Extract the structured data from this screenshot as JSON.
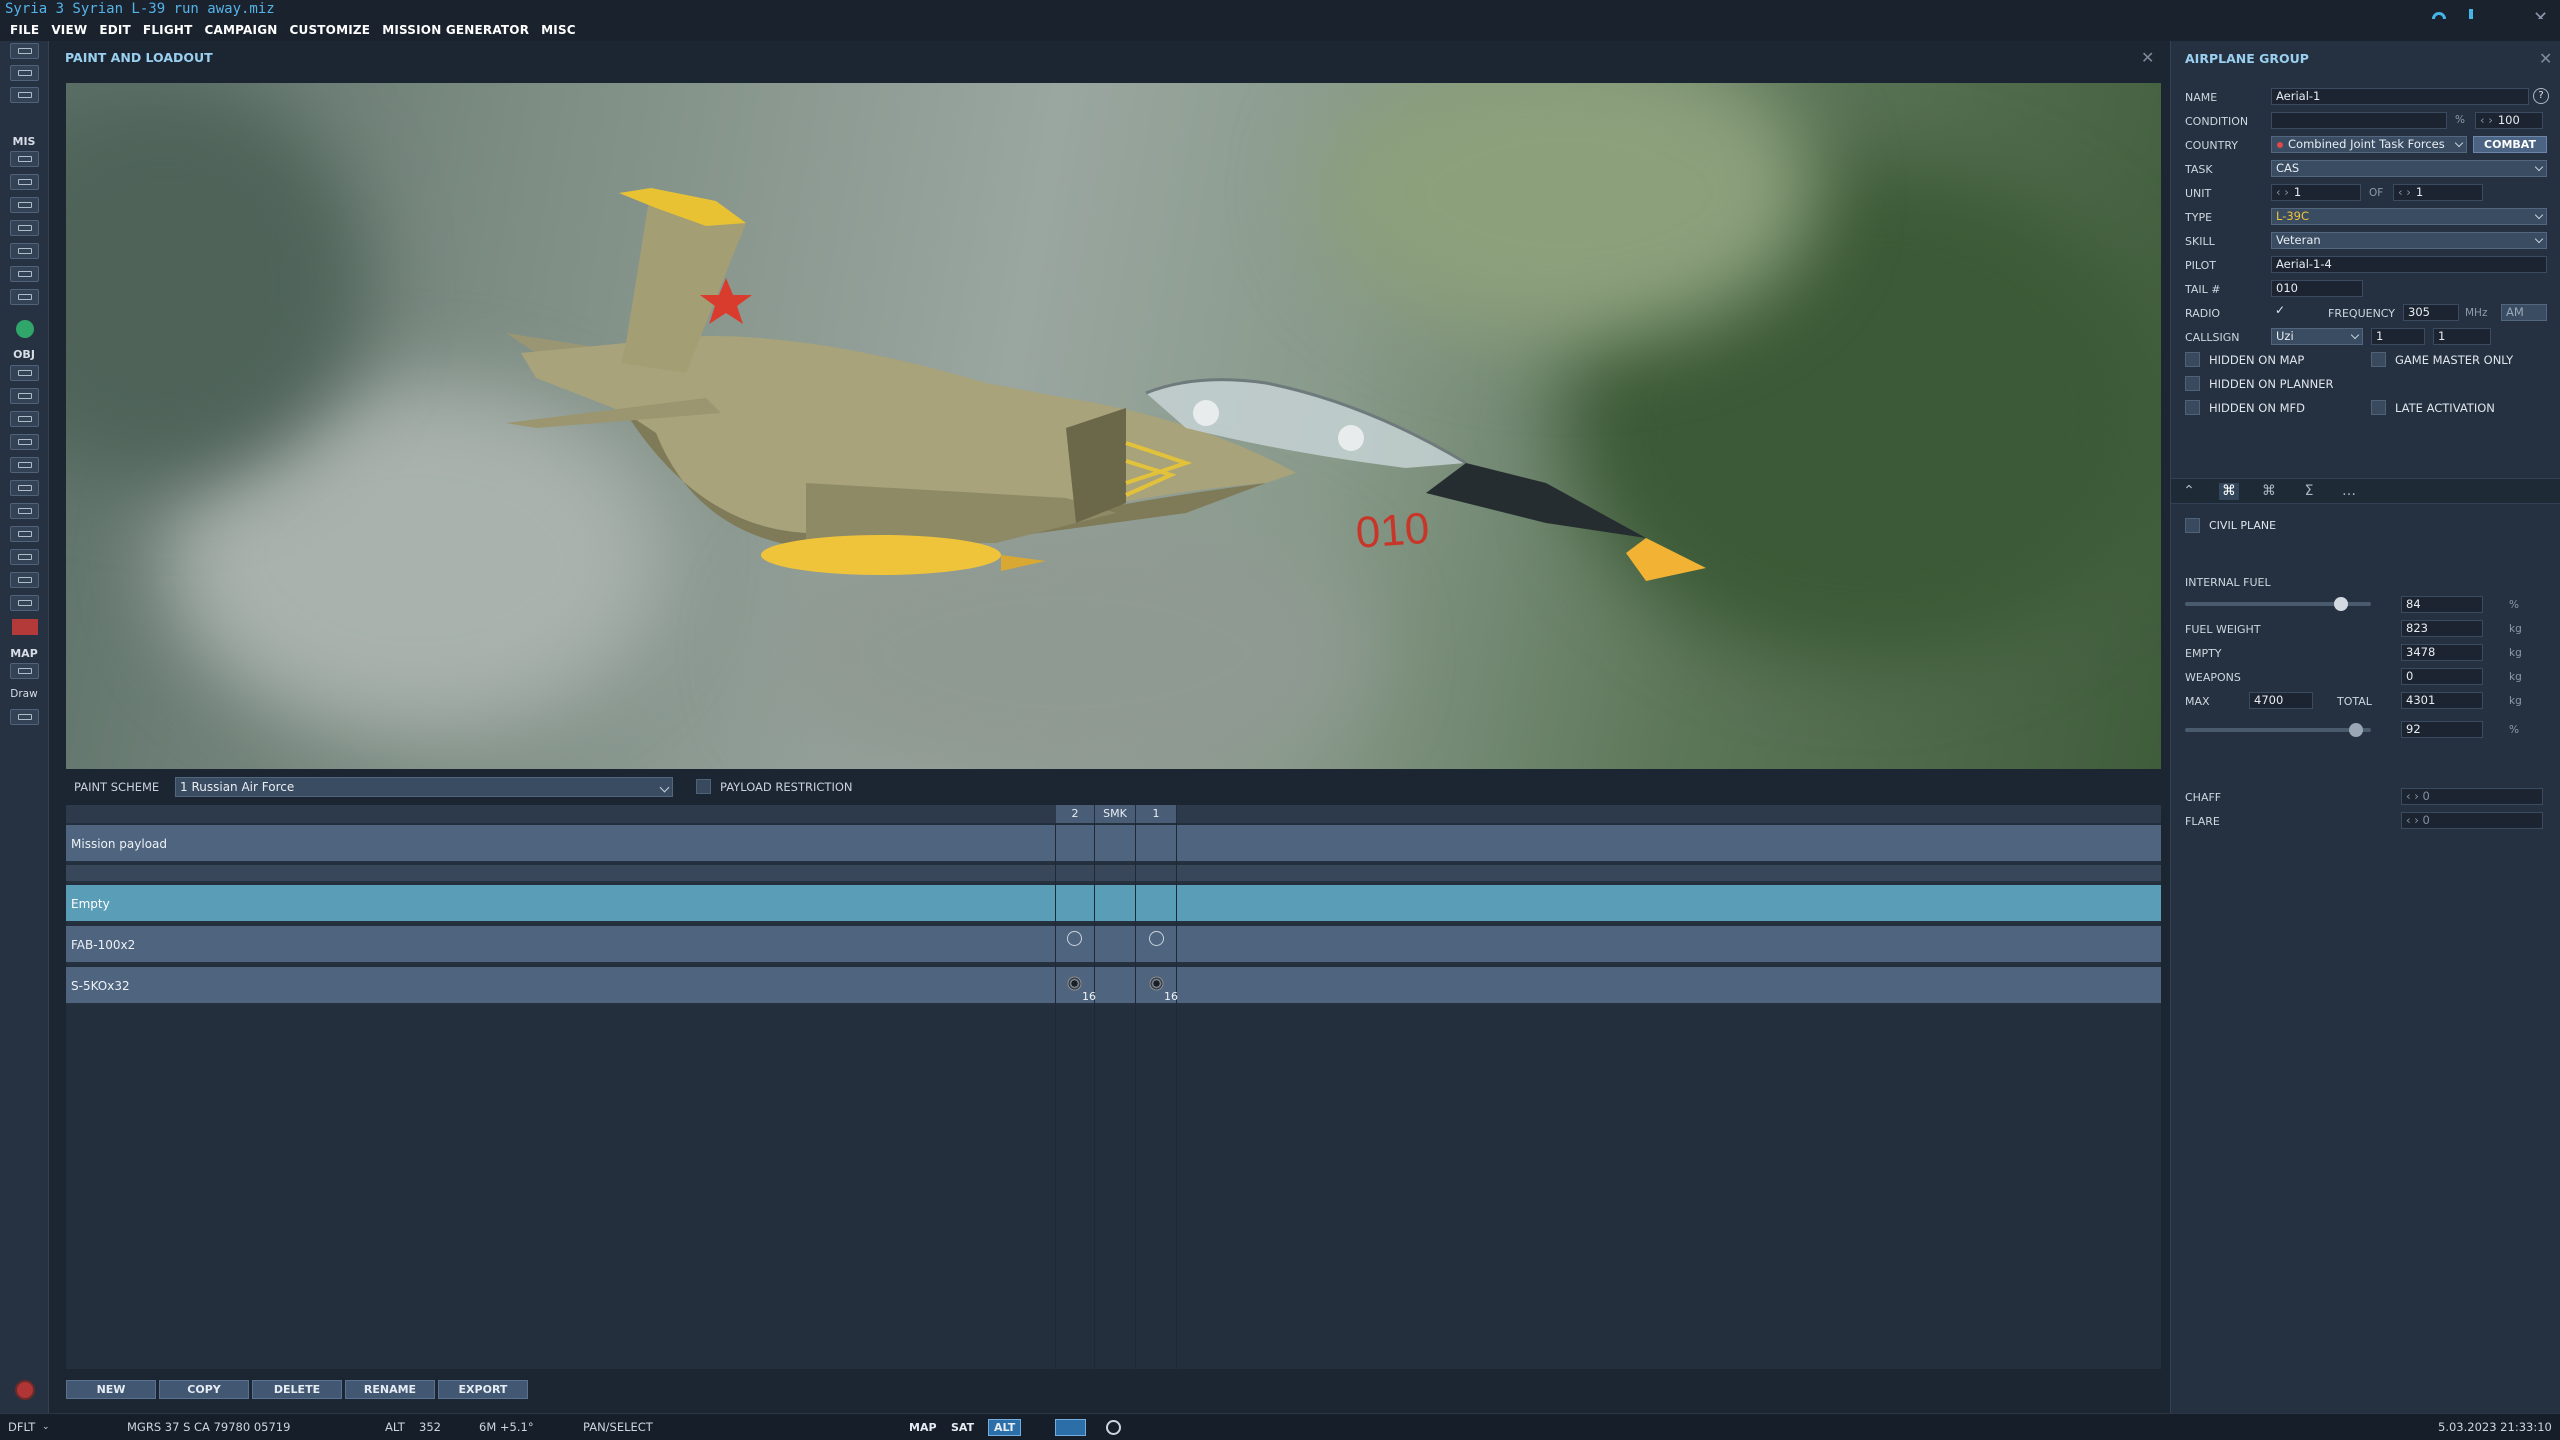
{
  "window": {
    "title": "Syria 3 Syrian L-39 run away.miz"
  },
  "menu": [
    "FILE",
    "VIEW",
    "EDIT",
    "FLIGHT",
    "CAMPAIGN",
    "CUSTOMIZE",
    "MISSION GENERATOR",
    "MISC"
  ],
  "toolbar": {
    "mis_label": "MIS",
    "obj_label": "OBJ",
    "map_label": "MAP",
    "draw_label": "Draw"
  },
  "paint_loadout": {
    "title": "PAINT AND LOADOUT",
    "paint_scheme_label": "PAINT SCHEME",
    "paint_scheme_value": "1 Russian Air Force",
    "payload_restriction_label": "PAYLOAD RESTRICTION",
    "aircraft_tail_number": "010",
    "columns": [
      "2",
      "SMK",
      "1"
    ],
    "mission_payload_label": "Mission payload",
    "rows": [
      {
        "name": "Empty",
        "selected": true,
        "slot2": "",
        "slot1": ""
      },
      {
        "name": "FAB-100x2",
        "selected": false,
        "slot2": "",
        "slot1": ""
      },
      {
        "name": "S-5KOx32",
        "selected": false,
        "slot2": "16",
        "slot1": "16"
      }
    ],
    "buttons": {
      "new": "NEW",
      "copy": "COPY",
      "delete": "DELETE",
      "rename": "RENAME",
      "export": "EXPORT"
    }
  },
  "airplane_group": {
    "title": "AIRPLANE GROUP",
    "name_label": "NAME",
    "name_value": "Aerial-1",
    "help_icon": "?",
    "condition_label": "CONDITION",
    "condition_unit": "%",
    "condition_value": "100",
    "country_label": "COUNTRY",
    "country_value": "Combined Joint Task Forces",
    "combat_label": "COMBAT",
    "task_label": "TASK",
    "task_value": "CAS",
    "unit_label": "UNIT",
    "unit_value": "1",
    "unit_of_label": "OF",
    "unit_of_value": "1",
    "type_label": "TYPE",
    "type_value": "L-39C",
    "skill_label": "SKILL",
    "skill_value": "Veteran",
    "pilot_label": "PILOT",
    "pilot_value": "Aerial-1-4",
    "tail_label": "TAIL #",
    "tail_value": "010",
    "radio_label": "RADIO",
    "frequency_label": "FREQUENCY",
    "frequency_value": "305",
    "frequency_unit": "MHz",
    "modulation": "AM",
    "callsign_label": "CALLSIGN",
    "callsign_value": "Uzi",
    "callsign_num1": "1",
    "callsign_num2": "1",
    "hidden_on_map": "HIDDEN ON MAP",
    "game_master_only": "GAME MASTER ONLY",
    "hidden_on_planner": "HIDDEN ON PLANNER",
    "hidden_on_mfd": "HIDDEN ON MFD",
    "late_activation": "LATE ACTIVATION",
    "tabs": [
      "waypoints-tab-icon",
      "payload-tab-icon",
      "summary-tab-icon",
      "sigma-tab-icon",
      "more-tab-icon"
    ],
    "civil_plane": "CIVIL PLANE",
    "internal_fuel_label": "INTERNAL FUEL",
    "internal_fuel_value": "84",
    "internal_fuel_fraction": 0.84,
    "fuel_weight_label": "FUEL WEIGHT",
    "fuel_weight_value": "823",
    "empty_label": "EMPTY",
    "empty_value": "3478",
    "weapons_label": "WEAPONS",
    "weapons_value": "0",
    "max_label": "MAX",
    "max_value": "4700",
    "total_label": "TOTAL",
    "total_value": "4301",
    "total_percent_value": "92",
    "total_fraction": 0.92,
    "pct": "%",
    "kg": "kg",
    "chaff_label": "CHAFF",
    "flare_label": "FLARE"
  },
  "status_bar": {
    "profile": "DFLT",
    "mgrs": "MGRS  37 S CA 79780 05719",
    "alt_label": "ALT",
    "alt_value": "352",
    "magvar": "6M  +5.1°",
    "mode": "PAN/SELECT",
    "map_btn": "MAP",
    "sat_btn": "SAT",
    "alt_btn": "ALT",
    "datetime": "5.03.2023 21:33:10"
  },
  "colors": {
    "accent": "#9ad0ef",
    "title_blue": "#55b3e8",
    "selected_row": "#5a9db7",
    "tail_yellow": "#f0c43a"
  }
}
